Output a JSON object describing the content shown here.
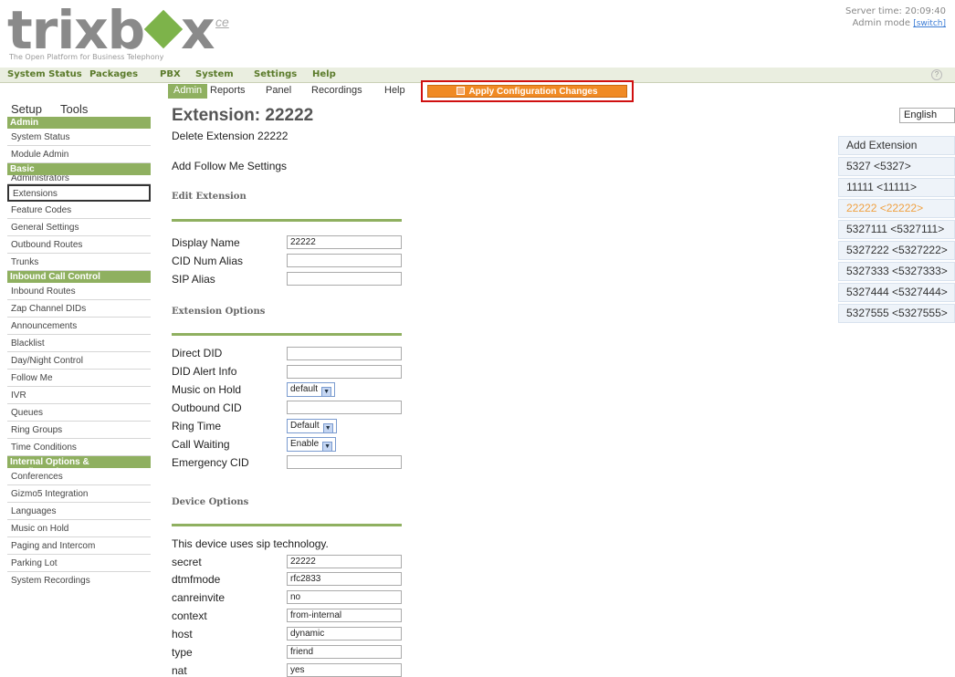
{
  "header": {
    "logo_left": "trixb",
    "logo_right": "x",
    "logo_suffix": "ce",
    "tagline": "The Open Platform for Business Telephony",
    "server_time": "Server time: 20:09:40",
    "admin_mode": "Admin mode",
    "switch_link": "[switch]"
  },
  "top_menu": [
    "System Status",
    "Packages",
    "PBX",
    "System",
    "Settings",
    "Help"
  ],
  "sub_menu": [
    "Admin",
    "Reports",
    "Panel",
    "Recordings",
    "Help"
  ],
  "apply_button": "Apply Configuration Changes",
  "sidebar": {
    "tabs": [
      "Setup",
      "Tools"
    ],
    "sections": [
      {
        "heading": "Admin",
        "items": [
          "System Status",
          "Module Admin"
        ]
      },
      {
        "heading": "Basic",
        "items": [
          "Administrators",
          "Extensions",
          "Feature Codes",
          "General Settings",
          "Outbound Routes",
          "Trunks"
        ]
      },
      {
        "heading": "Inbound Call Control",
        "items": [
          "Inbound Routes",
          "Zap Channel DIDs",
          "Announcements",
          "Blacklist",
          "Day/Night Control",
          "Follow Me",
          "IVR",
          "Queues",
          "Ring Groups",
          "Time Conditions"
        ]
      },
      {
        "heading": "Internal Options & Configuration",
        "items": [
          "Conferences",
          "Gizmo5 Integration",
          "Languages",
          "Music on Hold",
          "Paging and Intercom",
          "Parking Lot",
          "System Recordings"
        ]
      }
    ]
  },
  "main": {
    "title": "Extension: 22222",
    "delete_link": "Delete Extension 22222",
    "follow_me_link": "Add Follow Me Settings",
    "section_edit": "Edit Extension",
    "section_options": "Extension Options",
    "section_device": "Device Options",
    "device_note": "This device uses sip technology.",
    "fields": {
      "display_name": {
        "label": "Display Name",
        "value": "22222"
      },
      "cid_num_alias": {
        "label": "CID Num Alias",
        "value": ""
      },
      "sip_alias": {
        "label": "SIP Alias",
        "value": ""
      },
      "direct_did": {
        "label": "Direct DID",
        "value": ""
      },
      "did_alert_info": {
        "label": "DID Alert Info",
        "value": ""
      },
      "music_on_hold": {
        "label": "Music on Hold",
        "value": "default"
      },
      "outbound_cid": {
        "label": "Outbound CID",
        "value": ""
      },
      "ring_time": {
        "label": "Ring Time",
        "value": "Default"
      },
      "call_waiting": {
        "label": "Call Waiting",
        "value": "Enable"
      },
      "emergency_cid": {
        "label": "Emergency CID",
        "value": ""
      },
      "secret": {
        "label": "secret",
        "value": "22222"
      },
      "dtmfmode": {
        "label": "dtmfmode",
        "value": "rfc2833"
      },
      "canreinvite": {
        "label": "canreinvite",
        "value": "no"
      },
      "context": {
        "label": "context",
        "value": "from-internal"
      },
      "host": {
        "label": "host",
        "value": "dynamic"
      },
      "type": {
        "label": "type",
        "value": "friend"
      },
      "nat": {
        "label": "nat",
        "value": "yes"
      }
    }
  },
  "right_panel": {
    "language": "English",
    "extensions": [
      "Add Extension",
      "5327 <5327>",
      "11111 <11111>",
      "22222 <22222>",
      "5327111 <5327111>",
      "5327222 <5327222>",
      "5327333 <5327333>",
      "5327444 <5327444>",
      "5327555 <5327555>"
    ]
  },
  "colors": {
    "accent_green": "#8fb060",
    "apply_orange": "#f08a24",
    "highlight_red": "#d01010",
    "current_ext": "#f0a040"
  }
}
